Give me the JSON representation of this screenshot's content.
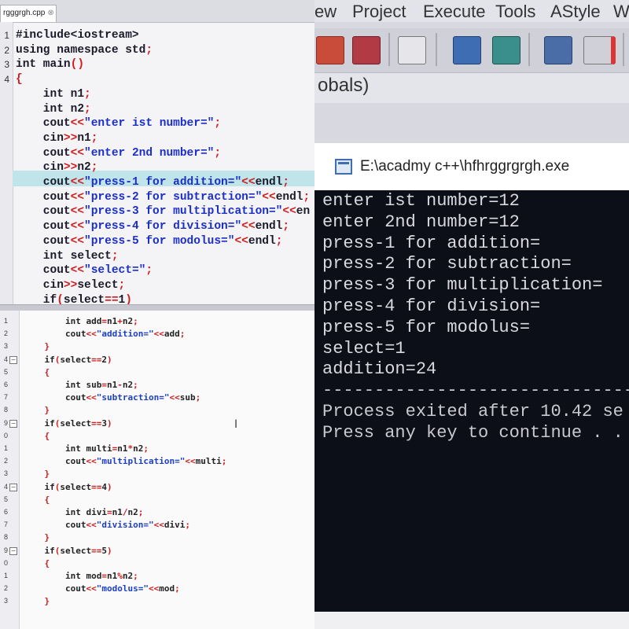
{
  "top_editor": {
    "tab": "rgggrgh.cpp",
    "lines": [
      {
        "ln": "1",
        "code": "#include<iostream>"
      },
      {
        "ln": "2",
        "code": "using namespace std;"
      },
      {
        "ln": "3",
        "code": "int main()"
      },
      {
        "ln": "4",
        "code": "{"
      },
      {
        "ln": "",
        "code": "    int n1;"
      },
      {
        "ln": "",
        "code": "    int n2;"
      },
      {
        "ln": "",
        "code": "    cout<<\"enter ist number=\";"
      },
      {
        "ln": "",
        "code": "    cin>>n1;"
      },
      {
        "ln": "",
        "code": "    cout<<\"enter 2nd number=\";"
      },
      {
        "ln": "",
        "code": "    cin>>n2;"
      },
      {
        "ln": "",
        "code": "    cout<<\"press-1 for addition=\"<<endl;"
      },
      {
        "ln": "",
        "code": "    cout<<\"press-2 for subtraction=\"<<endl;"
      },
      {
        "ln": "",
        "code": "    cout<<\"press-3 for multiplication=\"<<en"
      },
      {
        "ln": "",
        "code": "    cout<<\"press-4 for division=\"<<endl;"
      },
      {
        "ln": "",
        "code": "    cout<<\"press-5 for modolus=\"<<endl;"
      },
      {
        "ln": "",
        "code": "    int select;"
      },
      {
        "ln": "",
        "code": "    cout<<\"select=\";"
      },
      {
        "ln": "",
        "code": "    cin>>select;"
      },
      {
        "ln": "",
        "code": "    if(select==1)"
      }
    ]
  },
  "bottom_editor": {
    "lines": [
      {
        "ln": "1",
        "code": "        int add=n1+n2;"
      },
      {
        "ln": "2",
        "code": "        cout<<\"addition=\"<<add;"
      },
      {
        "ln": "3",
        "code": "    }"
      },
      {
        "ln": "4",
        "code": "    if(select==2)"
      },
      {
        "ln": "5",
        "code": "    {"
      },
      {
        "ln": "6",
        "code": "        int sub=n1-n2;"
      },
      {
        "ln": "7",
        "code": "        cout<<\"subtraction=\"<<sub;"
      },
      {
        "ln": "8",
        "code": "    }"
      },
      {
        "ln": "9",
        "code": "    if(select==3)"
      },
      {
        "ln": "0",
        "code": "    {"
      },
      {
        "ln": "1",
        "code": "        int multi=n1*n2;"
      },
      {
        "ln": "2",
        "code": "        cout<<\"multiplication=\"<<multi;"
      },
      {
        "ln": "3",
        "code": "    }"
      },
      {
        "ln": "4",
        "code": "    if(select==4)"
      },
      {
        "ln": "5",
        "code": "    {"
      },
      {
        "ln": "6",
        "code": "        int divi=n1/n2;"
      },
      {
        "ln": "7",
        "code": "        cout<<\"division=\"<<divi;"
      },
      {
        "ln": "8",
        "code": "    }"
      },
      {
        "ln": "9",
        "code": "    if(select==5)"
      },
      {
        "ln": "0",
        "code": "    {"
      },
      {
        "ln": "1",
        "code": "        int mod=n1%n2;"
      },
      {
        "ln": "2",
        "code": "        cout<<\"modolus=\"<<mod;"
      },
      {
        "ln": "3",
        "code": "    }"
      }
    ]
  },
  "ide": {
    "menu": [
      "ew",
      "Project",
      "Execute",
      "Tools",
      "AStyle",
      "W"
    ],
    "scope": "obals)"
  },
  "console": {
    "title": "E:\\acadmy c++\\hfhrggrgrgh.exe",
    "lines": [
      "enter ist number=12",
      "enter 2nd number=12",
      "press-1 for addition=",
      "press-2 for subtraction=",
      "press-3 for multiplication=",
      "press-4 for division=",
      "press-5 for modolus=",
      "select=1",
      "addition=24",
      "------------------------------",
      "Process exited after 10.42 se",
      "Press any key to continue . ."
    ]
  },
  "colors": {
    "string": "#1c2fc6",
    "operator": "#d01c1c",
    "highlight": "#bfe4ea",
    "console_bg": "#0d0f18"
  }
}
